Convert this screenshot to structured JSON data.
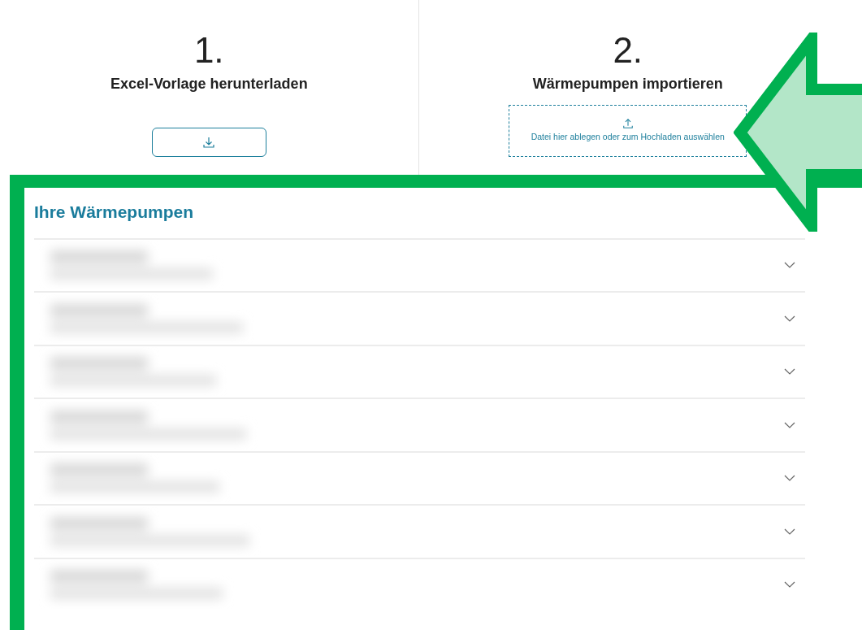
{
  "steps": [
    {
      "kind": "download",
      "number": "1.",
      "title": "Excel-Vorlage herunterladen"
    },
    {
      "kind": "upload",
      "number": "2.",
      "title": "Wärmepumpen importieren",
      "hint": "Datei hier ablegen oder zum Hochladen auswählen"
    }
  ],
  "list": {
    "title": "Ihre Wärmepumpen",
    "items": [
      {
        "expanded": false
      },
      {
        "expanded": false
      },
      {
        "expanded": false
      },
      {
        "expanded": false
      },
      {
        "expanded": false
      },
      {
        "expanded": false
      },
      {
        "expanded": false
      }
    ]
  }
}
